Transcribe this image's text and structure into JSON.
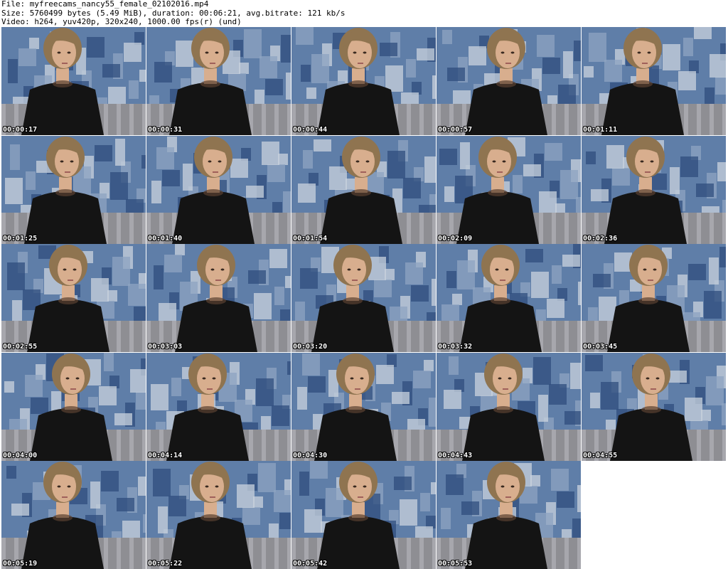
{
  "header": {
    "file_line": "File: myfreecams_nancy55_female_02102016.mp4",
    "size_line": "Size: 5760499 bytes (5.49 MiB), duration: 00:06:21, avg.bitrate: 121 kb/s",
    "video_line": "Video: h264, yuv420p, 320x240, 1000.00 fps(r) (und)"
  },
  "thumbnails": [
    {
      "time": "00:00:17"
    },
    {
      "time": "00:00:31"
    },
    {
      "time": "00:00:44"
    },
    {
      "time": "00:00:57"
    },
    {
      "time": "00:01:11"
    },
    {
      "time": "00:01:25"
    },
    {
      "time": "00:01:40"
    },
    {
      "time": "00:01:54"
    },
    {
      "time": "00:02:09"
    },
    {
      "time": "00:02:36"
    },
    {
      "time": "00:02:55"
    },
    {
      "time": "00:03:03"
    },
    {
      "time": "00:03:20"
    },
    {
      "time": "00:03:32"
    },
    {
      "time": "00:03:45"
    },
    {
      "time": "00:04:00"
    },
    {
      "time": "00:04:14"
    },
    {
      "time": "00:04:30"
    },
    {
      "time": "00:04:43"
    },
    {
      "time": "00:04:55"
    },
    {
      "time": "00:05:19"
    },
    {
      "time": "00:05:22"
    },
    {
      "time": "00:05:42"
    },
    {
      "time": "00:05:53"
    }
  ],
  "colors": {
    "wall": "#5f7ea8",
    "wall_light": "#c9d3de",
    "sweater": "#141414",
    "hair": "#8f7450",
    "skin": "#d8ae8e",
    "couch": "#8e8e93",
    "timestamp": "#ffffff"
  }
}
